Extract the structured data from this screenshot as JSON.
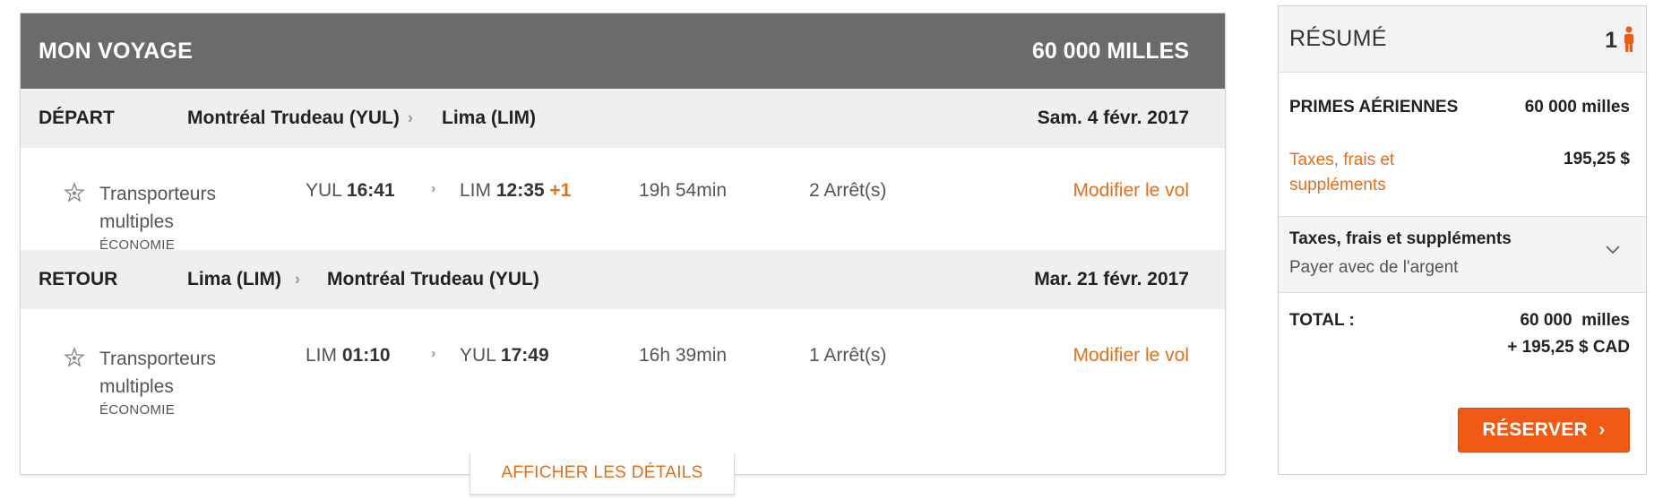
{
  "trip": {
    "title": "MON VOYAGE",
    "miles": "60 000 MILLES",
    "outbound": {
      "label": "DÉPART",
      "from": "Montréal Trudeau (YUL)",
      "to": "Lima (LIM)",
      "date": "Sam. 4 févr. 2017",
      "carrier": "Transporteurs multiples",
      "cabin": "ÉCONOMIE",
      "dep_code": "YUL",
      "dep_time": "16:41",
      "arr_code": "LIM",
      "arr_time": "12:35",
      "day_offset": "+1",
      "duration": "19h 54min",
      "stops": "2 Arrêt(s)",
      "modify": "Modifier le vol"
    },
    "return": {
      "label": "RETOUR",
      "from": "Lima (LIM)",
      "to": "Montréal Trudeau (YUL)",
      "date": "Mar. 21 févr. 2017",
      "carrier": "Transporteurs multiples",
      "cabin": "ÉCONOMIE",
      "dep_code": "LIM",
      "dep_time": "01:10",
      "arr_code": "YUL",
      "arr_time": "17:49",
      "duration": "16h 39min",
      "stops": "1 Arrêt(s)",
      "modify": "Modifier le vol"
    },
    "details_button": "AFFICHER LES DÉTAILS"
  },
  "summary": {
    "title": "RÉSUMÉ",
    "passengers": "1",
    "awards_label": "PRIMES AÉRIENNES",
    "awards_value": "60 000 milles",
    "taxes_label": "Taxes, frais et suppléments",
    "taxes_value": "195,25 $",
    "pay_title": "Taxes, frais et suppléments",
    "pay_subtitle": "Payer avec de l'argent",
    "total_label": "TOTAL :",
    "total_miles": "60 000  milles",
    "total_cash": "+ 195,25 $ CAD",
    "reserve_button": "RÉSERVER"
  },
  "icons": {
    "carrier": "multi-carrier-star-icon",
    "route_arrow": "chevron-right-icon",
    "passenger": "person-icon",
    "expand": "chevron-down-icon"
  },
  "colors": {
    "header_bg": "#6b6b6b",
    "accent_orange": "#e07020",
    "button_orange": "#f05a14",
    "segment_bg": "#efefef"
  }
}
